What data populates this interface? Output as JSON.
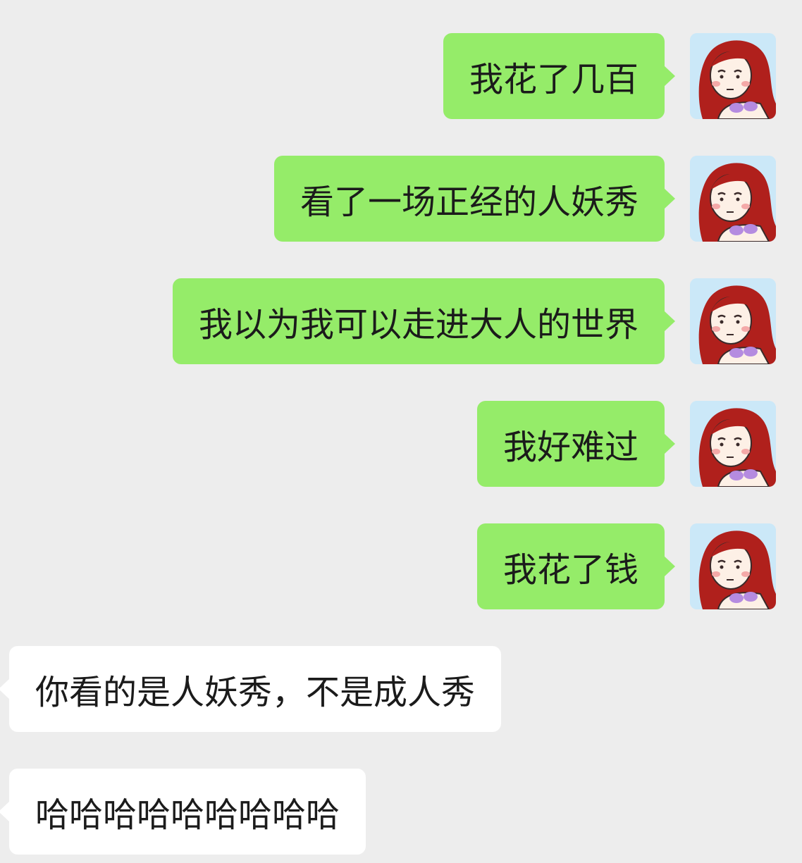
{
  "chat": {
    "messages": [
      {
        "side": "sent",
        "text": "我花了几百"
      },
      {
        "side": "sent",
        "text": "看了一场正经的人妖秀"
      },
      {
        "side": "sent",
        "text": "我以为我可以走进大人的世界"
      },
      {
        "side": "sent",
        "text": "我好难过"
      },
      {
        "side": "sent",
        "text": "我花了钱"
      },
      {
        "side": "received",
        "text": "你看的是人妖秀，不是成人秀"
      },
      {
        "side": "received",
        "text": "哈哈哈哈哈哈哈哈哈"
      }
    ],
    "avatar_icon": "cartoon-girl-red-hair-avatar"
  },
  "colors": {
    "background": "#ededed",
    "sent_bubble": "#95ec69",
    "received_bubble": "#ffffff",
    "text": "#1b1b1b",
    "avatar_bg": "#cbe8f8",
    "hair": "#b0201c"
  }
}
